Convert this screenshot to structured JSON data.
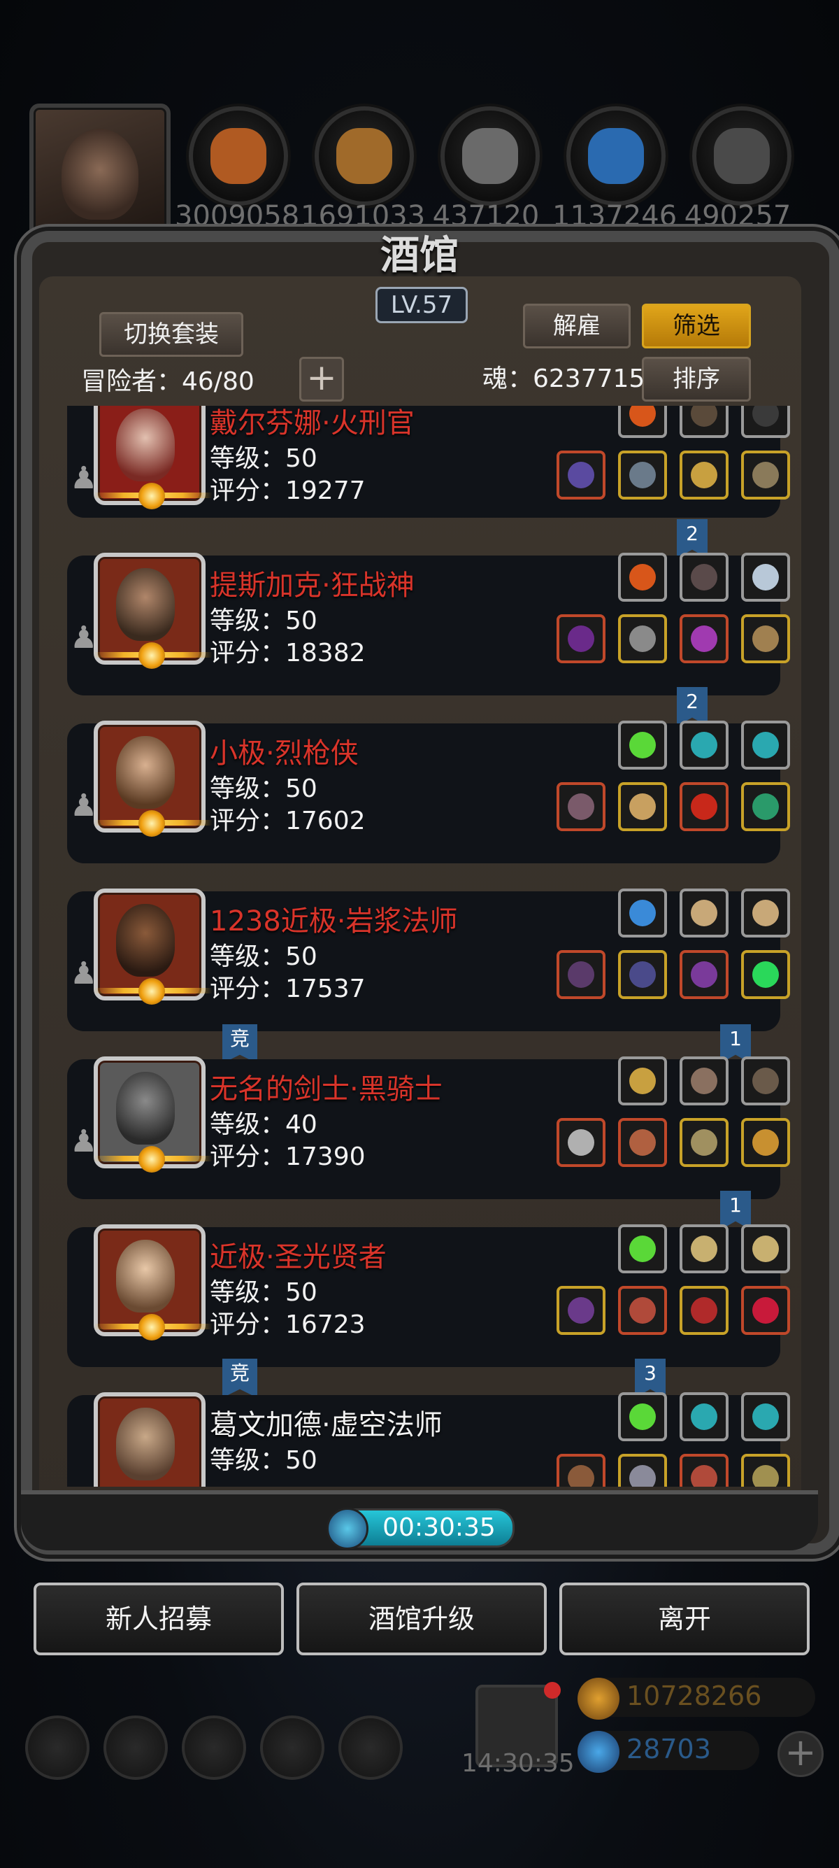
{
  "resources": [
    {
      "icon": "meat-icon",
      "value": "3009058",
      "color": "#b05a22"
    },
    {
      "icon": "wood-icon",
      "value": "1691033",
      "color": "#a06a2a"
    },
    {
      "icon": "stone-icon",
      "value": "437120",
      "color": "#6a6a6a"
    },
    {
      "icon": "crystal-icon",
      "value": "1137246",
      "color": "#2a6ab0"
    },
    {
      "icon": "iron-icon",
      "value": "490257",
      "color": "#4a4a4a"
    }
  ],
  "header": {
    "title": "酒馆",
    "level": "LV.57",
    "switch_outfit": "切换套装",
    "dismiss": "解雇",
    "filter": "筛选",
    "sort": "排序",
    "adventurers_label": "冒险者：46/80",
    "add_label": "+",
    "soul_label": "魂：6237715"
  },
  "heroes": [
    {
      "name": "戴尔芬娜·火刑官",
      "level": "等级：50",
      "score": "评分：19277",
      "name_color": "red",
      "flag": ""
    },
    {
      "name": "提斯加克·狂战神",
      "level": "等级：50",
      "score": "评分：18382",
      "name_color": "red",
      "flag": "2"
    },
    {
      "name": "小极·烈枪侠",
      "level": "等级：50",
      "score": "评分：17602",
      "name_color": "red",
      "flag": "2"
    },
    {
      "name": "1238近极·岩浆法师",
      "level": "等级：50",
      "score": "评分：17537",
      "name_color": "red",
      "flag": ""
    },
    {
      "name": "无名的剑士·黑骑士",
      "level": "等级：40",
      "score": "评分：17390",
      "name_color": "red",
      "flag": "1",
      "tag": "竞"
    },
    {
      "name": "近极·圣光贤者",
      "level": "等级：50",
      "score": "评分：16723",
      "name_color": "red",
      "flag": "1"
    },
    {
      "name": "葛文加德·虚空法师",
      "level": "等级：50",
      "score": "",
      "name_color": "white",
      "flag": "3",
      "tag": "竞"
    }
  ],
  "timer": "00:30:35",
  "buttons": {
    "recruit": "新人招募",
    "upgrade": "酒馆升级",
    "leave": "离开"
  },
  "footer": {
    "clock": "14:30:35",
    "gold": "10728266",
    "gems": "28703"
  }
}
